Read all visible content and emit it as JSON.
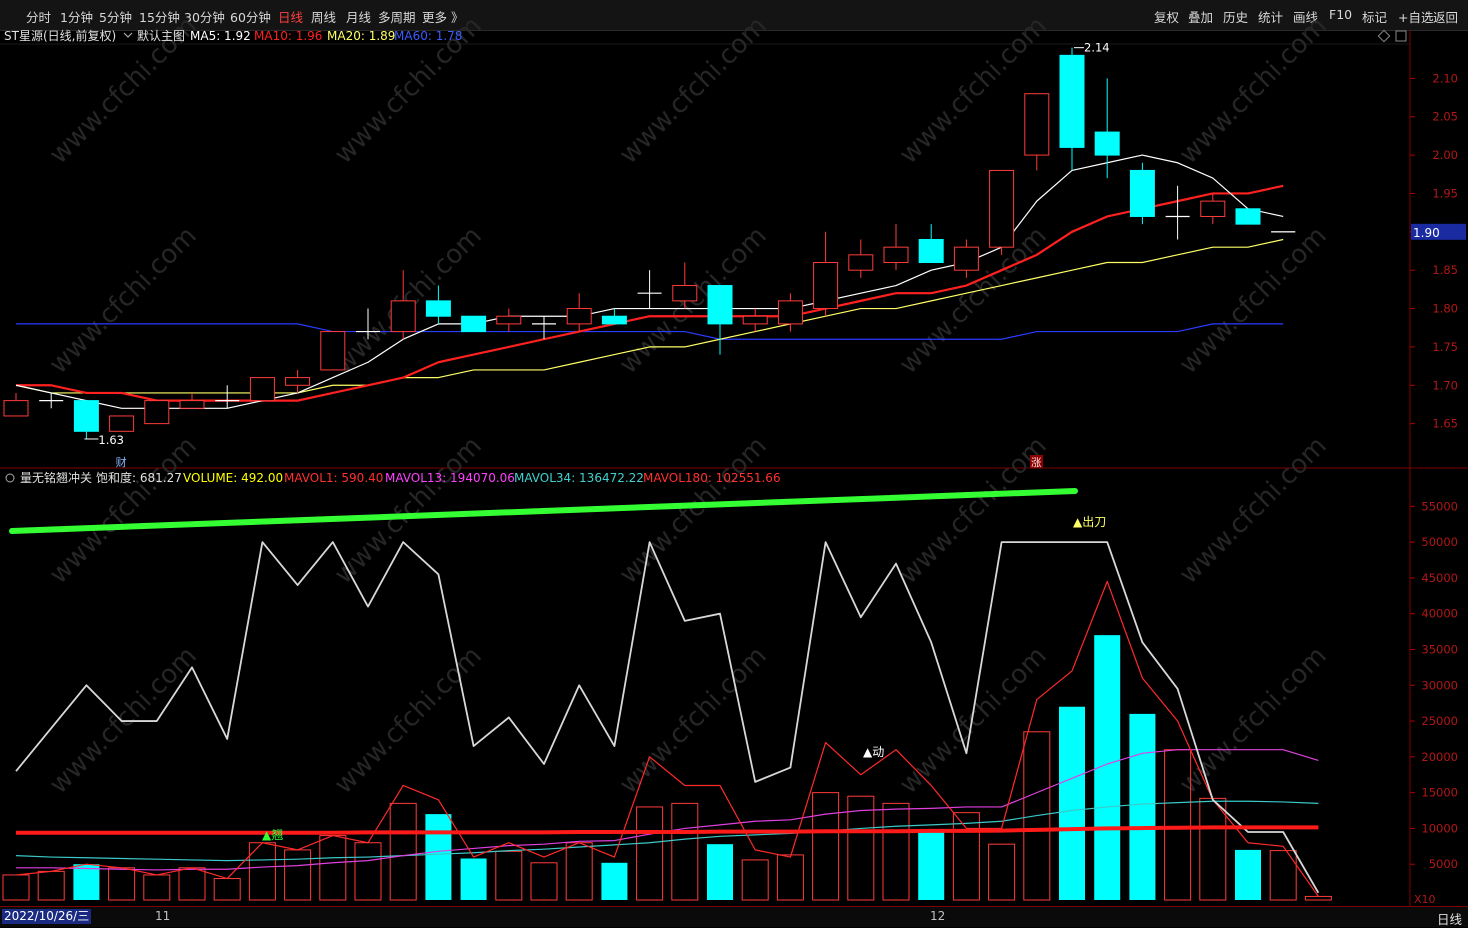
{
  "toolbar": {
    "left": [
      "分时",
      "1分钟",
      "5分钟",
      "15分钟",
      "30分钟",
      "60分钟",
      "日线",
      "周线",
      "月线",
      "多周期",
      "更多 》"
    ],
    "active_index": 6,
    "right": [
      "复权",
      "叠加",
      "历史",
      "统计",
      "画线",
      "F10",
      "标记",
      "+自选",
      "返回"
    ]
  },
  "main_header": {
    "name": "ST星源(日线,前复权)",
    "mode": "默认主图",
    "ma5": "MA5: 1.92",
    "ma10": "MA10: 1.96",
    "ma20": "MA20: 1.89",
    "ma60": "MA60: 1.78"
  },
  "sub_header": {
    "name": "量无铭翘冲关",
    "sat": "饱和度: 681.27",
    "volume": "VOLUME: 492.00",
    "mavol1": "MAVOL1: 590.40",
    "mavol13": "MAVOL13: 194070.06",
    "mavol34": "MAVOL34: 136472.22",
    "mavol180": "MAVOL180: 102551.66"
  },
  "price_axis": [
    "2.10",
    "2.05",
    "2.00",
    "1.95",
    "1.90",
    "1.85",
    "1.80",
    "1.75",
    "1.70",
    "1.65"
  ],
  "current_price": "1.90",
  "vol_axis": [
    "55000",
    "50000",
    "45000",
    "40000",
    "35000",
    "30000",
    "25000",
    "20000",
    "15000",
    "10000",
    "5000"
  ],
  "vol_unit": "X10",
  "annotations": {
    "high": "2.14",
    "low": "1.63",
    "cai": "财",
    "zhang": "涨",
    "chudao": "▲出刀",
    "dong": "▲动",
    "qiao": "▲翘"
  },
  "bottom": {
    "date": "2022/10/26/三",
    "ticks": [
      "11",
      "12"
    ],
    "period": "日线"
  },
  "colors": {
    "up": "#ff3b3b",
    "down": "#00ffff",
    "ma5": "#ffffff",
    "ma10": "#ff2020",
    "ma20": "#ffff66",
    "ma60": "#2a3cff",
    "green": "#33ff33"
  },
  "chart_data": {
    "type": "candlestick",
    "price_min": 1.6,
    "price_max": 2.15,
    "candles": [
      {
        "o": 1.66,
        "c": 1.68,
        "h": 1.69,
        "l": 1.66
      },
      {
        "o": 1.68,
        "c": 1.68,
        "h": 1.69,
        "l": 1.67
      },
      {
        "o": 1.68,
        "c": 1.64,
        "h": 1.68,
        "l": 1.63
      },
      {
        "o": 1.64,
        "c": 1.66,
        "h": 1.66,
        "l": 1.64
      },
      {
        "o": 1.65,
        "c": 1.68,
        "h": 1.68,
        "l": 1.65
      },
      {
        "o": 1.67,
        "c": 1.68,
        "h": 1.69,
        "l": 1.67
      },
      {
        "o": 1.68,
        "c": 1.68,
        "h": 1.7,
        "l": 1.67
      },
      {
        "o": 1.68,
        "c": 1.71,
        "h": 1.71,
        "l": 1.68
      },
      {
        "o": 1.7,
        "c": 1.71,
        "h": 1.72,
        "l": 1.69
      },
      {
        "o": 1.72,
        "c": 1.77,
        "h": 1.77,
        "l": 1.72
      },
      {
        "o": 1.77,
        "c": 1.77,
        "h": 1.8,
        "l": 1.76
      },
      {
        "o": 1.77,
        "c": 1.81,
        "h": 1.85,
        "l": 1.76
      },
      {
        "o": 1.81,
        "c": 1.79,
        "h": 1.83,
        "l": 1.78
      },
      {
        "o": 1.79,
        "c": 1.77,
        "h": 1.79,
        "l": 1.77
      },
      {
        "o": 1.78,
        "c": 1.79,
        "h": 1.8,
        "l": 1.77
      },
      {
        "o": 1.78,
        "c": 1.78,
        "h": 1.79,
        "l": 1.76
      },
      {
        "o": 1.78,
        "c": 1.8,
        "h": 1.82,
        "l": 1.77
      },
      {
        "o": 1.79,
        "c": 1.78,
        "h": 1.8,
        "l": 1.78
      },
      {
        "o": 1.82,
        "c": 1.82,
        "h": 1.85,
        "l": 1.8
      },
      {
        "o": 1.81,
        "c": 1.83,
        "h": 1.86,
        "l": 1.8
      },
      {
        "o": 1.83,
        "c": 1.78,
        "h": 1.83,
        "l": 1.74
      },
      {
        "o": 1.78,
        "c": 1.79,
        "h": 1.8,
        "l": 1.77
      },
      {
        "o": 1.78,
        "c": 1.81,
        "h": 1.82,
        "l": 1.77
      },
      {
        "o": 1.8,
        "c": 1.86,
        "h": 1.9,
        "l": 1.79
      },
      {
        "o": 1.85,
        "c": 1.87,
        "h": 1.89,
        "l": 1.84
      },
      {
        "o": 1.86,
        "c": 1.88,
        "h": 1.91,
        "l": 1.85
      },
      {
        "o": 1.89,
        "c": 1.86,
        "h": 1.91,
        "l": 1.86
      },
      {
        "o": 1.85,
        "c": 1.88,
        "h": 1.89,
        "l": 1.84
      },
      {
        "o": 1.88,
        "c": 1.98,
        "h": 1.98,
        "l": 1.87
      },
      {
        "o": 2.0,
        "c": 2.08,
        "h": 2.08,
        "l": 1.98
      },
      {
        "o": 2.13,
        "c": 2.01,
        "h": 2.14,
        "l": 1.98
      },
      {
        "o": 2.03,
        "c": 2.0,
        "h": 2.1,
        "l": 1.97
      },
      {
        "o": 1.98,
        "c": 1.92,
        "h": 1.99,
        "l": 1.91
      },
      {
        "o": 1.92,
        "c": 1.92,
        "h": 1.96,
        "l": 1.89
      },
      {
        "o": 1.92,
        "c": 1.94,
        "h": 1.95,
        "l": 1.91
      },
      {
        "o": 1.93,
        "c": 1.91,
        "h": 1.93,
        "l": 1.91
      },
      {
        "o": 1.9,
        "c": 1.9,
        "h": 1.9,
        "l": 1.9
      }
    ],
    "ma5": [
      1.7,
      1.69,
      1.68,
      1.67,
      1.67,
      1.67,
      1.67,
      1.68,
      1.69,
      1.71,
      1.73,
      1.76,
      1.78,
      1.78,
      1.79,
      1.79,
      1.79,
      1.8,
      1.8,
      1.8,
      1.8,
      1.8,
      1.8,
      1.81,
      1.82,
      1.83,
      1.85,
      1.86,
      1.88,
      1.94,
      1.98,
      1.99,
      2.0,
      1.99,
      1.97,
      1.93,
      1.92
    ],
    "ma10": [
      1.7,
      1.7,
      1.69,
      1.69,
      1.68,
      1.68,
      1.68,
      1.68,
      1.68,
      1.69,
      1.7,
      1.71,
      1.73,
      1.74,
      1.75,
      1.76,
      1.77,
      1.78,
      1.79,
      1.79,
      1.79,
      1.79,
      1.79,
      1.8,
      1.81,
      1.82,
      1.82,
      1.83,
      1.85,
      1.87,
      1.9,
      1.92,
      1.93,
      1.94,
      1.95,
      1.95,
      1.96
    ],
    "ma20": [
      1.7,
      1.69,
      1.69,
      1.69,
      1.69,
      1.69,
      1.69,
      1.69,
      1.69,
      1.7,
      1.7,
      1.71,
      1.71,
      1.72,
      1.72,
      1.72,
      1.73,
      1.74,
      1.75,
      1.75,
      1.76,
      1.77,
      1.78,
      1.79,
      1.8,
      1.8,
      1.81,
      1.82,
      1.83,
      1.84,
      1.85,
      1.86,
      1.86,
      1.87,
      1.88,
      1.88,
      1.89
    ],
    "ma60": [
      1.78,
      1.78,
      1.78,
      1.78,
      1.78,
      1.78,
      1.78,
      1.78,
      1.78,
      1.77,
      1.77,
      1.77,
      1.77,
      1.77,
      1.77,
      1.77,
      1.77,
      1.77,
      1.77,
      1.77,
      1.76,
      1.76,
      1.76,
      1.76,
      1.76,
      1.76,
      1.76,
      1.76,
      1.76,
      1.77,
      1.77,
      1.77,
      1.77,
      1.77,
      1.78,
      1.78,
      1.78
    ],
    "vol_max": 57000,
    "volume": [
      3500,
      4000,
      5000,
      4500,
      3500,
      4500,
      3000,
      8000,
      7000,
      9000,
      8000,
      13500,
      12000,
      5800,
      6800,
      5200,
      8000,
      5200,
      13000,
      13500,
      7800,
      5600,
      6300,
      15000,
      14500,
      13500,
      9500,
      12200,
      7800,
      23500,
      27000,
      37000,
      26000,
      21000,
      14200,
      7000,
      6900,
      500
    ],
    "mavol1": [
      3500,
      4000,
      5000,
      4500,
      3500,
      4500,
      3000,
      8000,
      7000,
      9000,
      8000,
      16000,
      14000,
      6000,
      8000,
      6000,
      8000,
      6000,
      20000,
      16000,
      16000,
      7000,
      6000,
      22000,
      17500,
      21000,
      16000,
      10000,
      10000,
      28000,
      32000,
      44500,
      31000,
      25000,
      14000,
      8000,
      7500,
      500
    ],
    "mavol13": [
      4500,
      4500,
      4400,
      4300,
      4200,
      4300,
      4300,
      4600,
      4800,
      5200,
      5500,
      6200,
      6800,
      7200,
      7600,
      7800,
      8200,
      8300,
      9200,
      10000,
      10500,
      11000,
      11200,
      12000,
      12500,
      12700,
      12800,
      13000,
      13000,
      15000,
      17000,
      19000,
      20500,
      21000,
      21000,
      21000,
      21000,
      19500
    ],
    "mavol34": [
      6200,
      6000,
      5900,
      5800,
      5700,
      5600,
      5500,
      5600,
      5700,
      5900,
      6000,
      6200,
      6400,
      6600,
      6900,
      7100,
      7400,
      7700,
      8000,
      8500,
      8900,
      9100,
      9300,
      9600,
      10000,
      10300,
      10500,
      10700,
      11000,
      11800,
      12500,
      13000,
      13400,
      13600,
      13800,
      13800,
      13700,
      13500
    ],
    "mavol180": [
      9400,
      9400,
      9400,
      9400,
      9400,
      9400,
      9400,
      9400,
      9400,
      9400,
      9450,
      9450,
      9450,
      9450,
      9450,
      9450,
      9500,
      9500,
      9500,
      9500,
      9550,
      9550,
      9550,
      9600,
      9600,
      9600,
      9650,
      9650,
      9700,
      9800,
      9900,
      10000,
      10050,
      10100,
      10150,
      10150,
      10150,
      10150
    ],
    "saturation": [
      18000,
      24000,
      30000,
      25000,
      25000,
      32500,
      22500,
      50000,
      44000,
      50000,
      41000,
      50000,
      45500,
      21500,
      25500,
      19000,
      30000,
      21500,
      50000,
      39000,
      40000,
      16500,
      18500,
      50000,
      39500,
      47000,
      36000,
      20500,
      50000,
      50000,
      50000,
      50000,
      36000,
      29500,
      14000,
      9500,
      9500,
      1000
    ]
  }
}
